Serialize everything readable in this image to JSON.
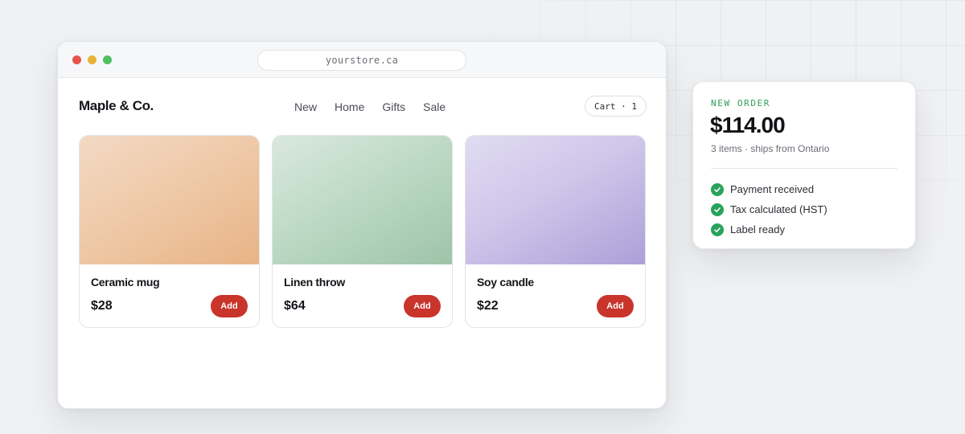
{
  "browser": {
    "url": "yourstore.ca"
  },
  "store": {
    "logo": "Maple & Co.",
    "nav": [
      "New",
      "Home",
      "Gifts",
      "Sale"
    ],
    "cart_label": "Cart · 1"
  },
  "products": [
    {
      "name": "Ceramic mug",
      "price": "$28",
      "add_label": "Add"
    },
    {
      "name": "Linen throw",
      "price": "$64",
      "add_label": "Add"
    },
    {
      "name": "Soy candle",
      "price": "$22",
      "add_label": "Add"
    }
  ],
  "order": {
    "label": "NEW ORDER",
    "total": "$114.00",
    "subtitle": "3 items · ships from Ontario",
    "checks": [
      "Payment received",
      "Tax calculated (HST)",
      "Label ready"
    ]
  },
  "colors": {
    "accent_red": "#c9342b",
    "success_green": "#27a35a",
    "label_green": "#2e9e58"
  }
}
